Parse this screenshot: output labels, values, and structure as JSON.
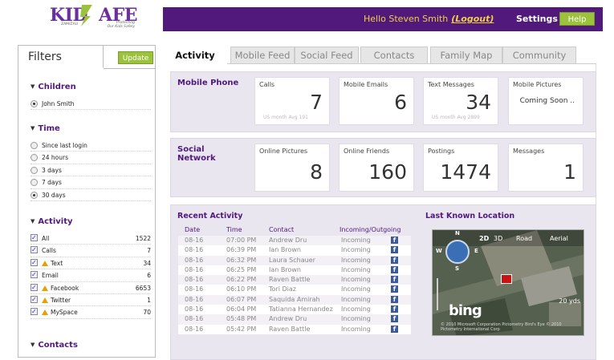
{
  "logo": {
    "text_kid": "KID",
    "text_afe": "AFE",
    "tagline_1": "Protecting",
    "tagline_2": "Our Kids Safely",
    "brand_sub": "ZAM/ZAU"
  },
  "header": {
    "greeting": "Hello Steven Smith",
    "logout": "(Logout)",
    "settings": "Settings",
    "help": "Help"
  },
  "filters": {
    "title": "Filters",
    "update": "Update",
    "children": {
      "heading": "Children",
      "items": [
        {
          "label": "John Smith",
          "selected": true
        }
      ]
    },
    "time": {
      "heading": "Time",
      "items": [
        {
          "label": "Since last login"
        },
        {
          "label": "24 hours"
        },
        {
          "label": "3 days"
        },
        {
          "label": "7 days"
        },
        {
          "label": "30 days",
          "selected": true
        }
      ]
    },
    "activity": {
      "heading": "Activity",
      "items": [
        {
          "label": "All",
          "count": "1522"
        },
        {
          "label": "Calls",
          "count": "7"
        },
        {
          "label": "Text",
          "count": "34"
        },
        {
          "label": "Email",
          "count": "6"
        },
        {
          "label": "Facebook",
          "count": "6653"
        },
        {
          "label": "Twitter",
          "count": "1"
        },
        {
          "label": "MySpace",
          "count": "70"
        }
      ]
    },
    "contacts": {
      "heading": "Contacts"
    }
  },
  "tabs": [
    "Activity",
    "Mobile Feed",
    "Social Feed",
    "Contacts",
    "Family Map",
    "Community"
  ],
  "mobile": {
    "title": "Mobile Phone",
    "cards": [
      {
        "label": "Calls",
        "value": "7",
        "avg": "US month Avg 191"
      },
      {
        "label": "Mobile Emails",
        "value": "6",
        "avg": ""
      },
      {
        "label": "Text Messages",
        "value": "34",
        "avg": "US month Avg 2899"
      },
      {
        "label": "Mobile Pictures",
        "value": "Coming Soon ..",
        "avg": ""
      }
    ]
  },
  "social": {
    "title_1": "Social",
    "title_2": "Network",
    "cards": [
      {
        "label": "Online Pictures",
        "value": "8"
      },
      {
        "label": "Online Friends",
        "value": "160"
      },
      {
        "label": "Postings",
        "value": "1474"
      },
      {
        "label": "Messages",
        "value": "1"
      }
    ]
  },
  "recent": {
    "title": "Recent Activity",
    "columns": [
      "Date",
      "Time",
      "Contact",
      "Incoming/Outgoing"
    ],
    "rows": [
      [
        "08-16",
        "07:00 PM",
        "Andrew Dru",
        "Incoming"
      ],
      [
        "08-16",
        "06:39 PM",
        "Ian Brown",
        "Incoming"
      ],
      [
        "08-16",
        "06:32 PM",
        "Laura Schauer",
        "Incoming"
      ],
      [
        "08-16",
        "06:25 PM",
        "Ian Brown",
        "Incoming"
      ],
      [
        "08-16",
        "06:22 PM",
        "Raven Battle",
        "Incoming"
      ],
      [
        "08-16",
        "06:10 PM",
        "Tori Diaz",
        "Incoming"
      ],
      [
        "08-16",
        "06:07 PM",
        "Saquida Amirah",
        "Incoming"
      ],
      [
        "08-16",
        "06:04 PM",
        "Tatianna Hernandez",
        "Incoming"
      ],
      [
        "08-16",
        "05:48 PM",
        "Andrew Dru",
        "Incoming"
      ],
      [
        "08-16",
        "05:42 PM",
        "Raven Battle",
        "Incoming"
      ]
    ],
    "source_icon": "facebook-icon"
  },
  "location": {
    "title": "Last Known Location",
    "map_options": [
      "2D",
      "3D",
      "Road",
      "Aerial"
    ],
    "scale": "20 yds",
    "brand": "bing",
    "copyright": "© 2010 Microsoft Corporation  Pictometry Bird's Eye © 2010 Pictometry International Corp"
  }
}
